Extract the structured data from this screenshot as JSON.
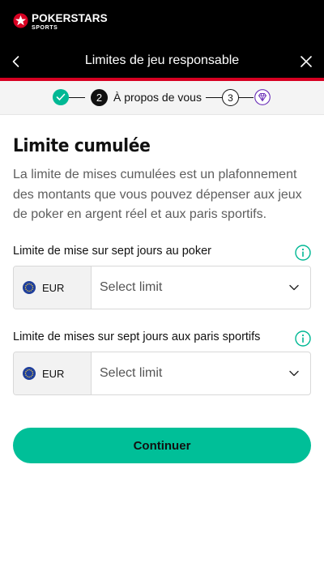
{
  "brand": {
    "name": "POKERSTARS",
    "sub": "SPORTS",
    "logo_icon": "pokerstars-star-logo"
  },
  "header": {
    "title": "Limites de jeu responsable",
    "back_icon": "chevron-left-icon",
    "close_icon": "close-icon"
  },
  "stepper": {
    "step1_icon": "check-icon",
    "current_number": "2",
    "current_label": "À propos de vous",
    "step3_number": "3",
    "final_icon": "diamond-icon"
  },
  "section": {
    "title": "Limite cumulée",
    "description": "La limite de mises cumulées est un plafonnement des montants que vous pouvez dépenser aux jeux de poker en argent réel et aux paris sportifs."
  },
  "fields": [
    {
      "label": "Limite de mise sur sept jours au poker",
      "currency": "EUR",
      "placeholder": "Select limit"
    },
    {
      "label": "Limite de mises sur sept jours aux paris sportifs",
      "currency": "EUR",
      "placeholder": "Select limit"
    }
  ],
  "continue_label": "Continuer",
  "colors": {
    "accent": "#00bf98",
    "brand_red": "#d70022",
    "header_bg": "#000000",
    "step_done": "#00b894"
  }
}
